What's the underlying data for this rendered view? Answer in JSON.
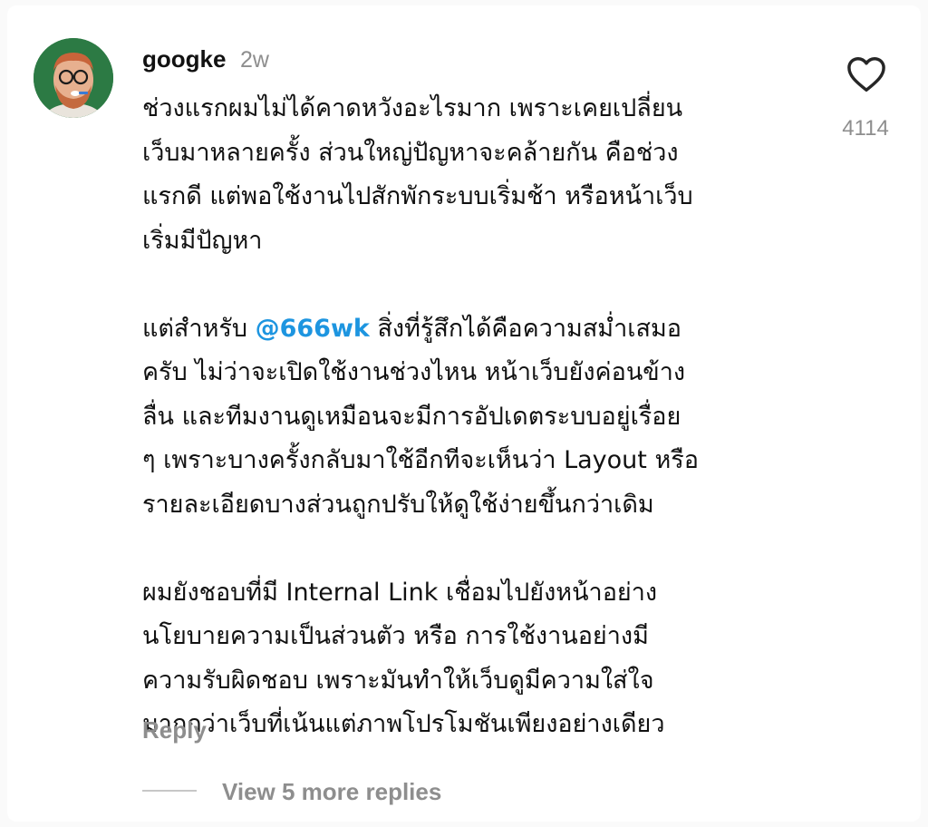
{
  "comment": {
    "username": "googke",
    "timestamp": "2w",
    "paragraphs": [
      {
        "lines": [
          "ช่วงแรกผมไม่ได้คาดหวังอะไรมาก เพราะเคยเปลี่ยน",
          "เว็บมาหลายครั้ง ส่วนใหญ่ปัญหาจะคล้ายกัน คือช่วง",
          "แรกดี แต่พอใช้งานไปสักพักระบบเริ่มช้า หรือหน้าเว็บ",
          "เริ่มมีปัญหา"
        ]
      },
      {
        "line1_before": "แต่สำหรับ ",
        "mention": "@666wk",
        "line1_after": " สิ่งที่รู้สึกได้คือความสม่ำเสมอ",
        "lines": [
          "ครับ ไม่ว่าจะเปิดใช้งานช่วงไหน หน้าเว็บยังค่อนข้าง",
          "ลื่น และทีมงานดูเหมือนจะมีการอัปเดตระบบอยู่เรื่อย",
          "ๆ เพราะบางครั้งกลับมาใช้อีกทีจะเห็นว่า Layout หรือ",
          "รายละเอียดบางส่วนถูกปรับให้ดูใช้ง่ายขึ้นกว่าเดิม"
        ]
      },
      {
        "lines": [
          "ผมยังชอบที่มี Internal Link เชื่อมไปยังหน้าอย่าง",
          "นโยบายความเป็นส่วนตัว หรือ การใช้งานอย่างมี",
          "ความรับผิดชอบ เพราะมันทำให้เว็บดูมีความใส่ใจ",
          "มากกว่าเว็บที่เน้นแต่ภาพโปรโมชันเพียงอย่างเดียว"
        ]
      }
    ],
    "like_icon": "heart-outline-icon",
    "like_count": "4114",
    "reply_label": "Reply",
    "view_replies_label": "View 5 more replies"
  },
  "colors": {
    "mention": "#1d95e0",
    "muted": "#8e8e8e",
    "text": "#111111",
    "avatar_bg": "#2c7a44"
  }
}
